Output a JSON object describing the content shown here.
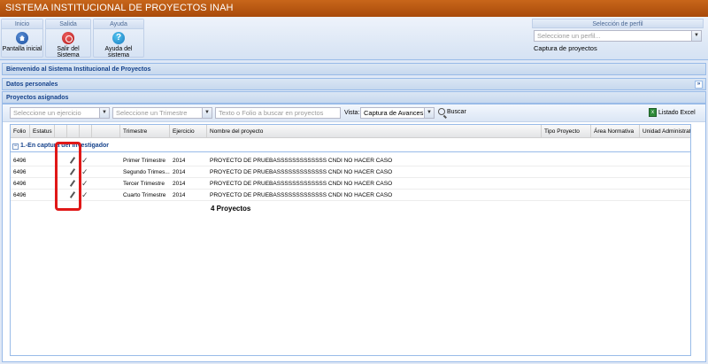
{
  "app": {
    "title": "SISTEMA INSTITUCIONAL DE PROYECTOS INAH"
  },
  "ribbon": {
    "groups": [
      {
        "title": "Inicio",
        "button": "Pantalla inicial",
        "icon": "home-icon"
      },
      {
        "title": "Salida",
        "button": "Salir del Sistema",
        "icon": "exit-icon"
      },
      {
        "title": "Ayuda",
        "button": "Ayuda del sistema",
        "icon": "help-icon"
      }
    ],
    "help_glyph": "?"
  },
  "profile": {
    "title": "Selección de perfil",
    "placeholder": "Seleccione un perfil...",
    "caption": "Captura de proyectos"
  },
  "panels": {
    "welcome": "Bienvenido al Sistema Institucional de Proyectos",
    "personal": "Datos personales",
    "assigned": "Proyectos asignados"
  },
  "toolbar": {
    "ejercicio_placeholder": "Seleccione un ejercicio",
    "trimestre_placeholder": "Seleccione un Trimestre",
    "search_placeholder": "Texto o Folio a buscar en proyectos",
    "vista_label": "Vista:",
    "vista_value": "Captura de  Avances",
    "search_button": "Buscar",
    "excel_button": "Listado Excel"
  },
  "grid": {
    "columns": [
      "Folio",
      "Estatus",
      "",
      "",
      "",
      "",
      "Trimestre",
      "Ejercicio",
      "Nombre del proyecto",
      "Tipo Proyecto",
      "Área Normativa",
      "Unidad Administrativa"
    ],
    "group_label": "1.-En captura del investigador",
    "rows": [
      {
        "folio": "6496",
        "trimestre": "Primer Trimestre",
        "ejercicio": "2014",
        "nombre": "PROYECTO DE PRUEBASSSSSSSSSSSSS CNDI NO HACER CASO"
      },
      {
        "folio": "6496",
        "trimestre": "Segundo Trimes...",
        "ejercicio": "2014",
        "nombre": "PROYECTO DE PRUEBASSSSSSSSSSSSS CNDI NO HACER CASO"
      },
      {
        "folio": "6496",
        "trimestre": "Tercer Trimestre",
        "ejercicio": "2014",
        "nombre": "PROYECTO DE PRUEBASSSSSSSSSSSSS CNDI NO HACER CASO"
      },
      {
        "folio": "6496",
        "trimestre": "Cuarto Trimestre",
        "ejercicio": "2014",
        "nombre": "PROYECTO DE PRUEBASSSSSSSSSSSSS CNDI NO HACER CASO"
      }
    ],
    "summary": "4 Proyectos"
  },
  "colors": {
    "title_bar": "#b35010",
    "accent": "#15428b",
    "highlight": "#e01818"
  }
}
